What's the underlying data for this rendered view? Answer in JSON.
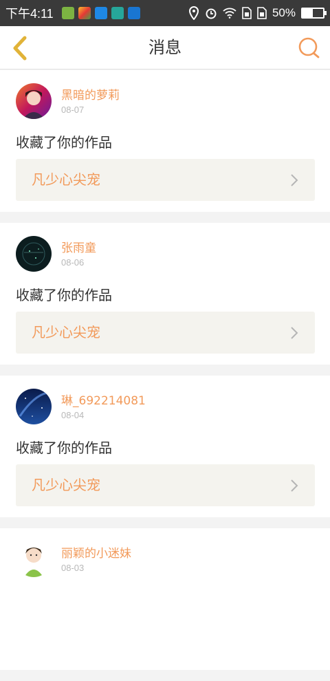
{
  "status_bar": {
    "time": "下午4:11",
    "battery_text": "50%",
    "battery_level": 0.5,
    "icons": [
      "app-icon-1",
      "app-icon-2",
      "app-icon-3",
      "app-icon-4",
      "app-icon-5",
      "location-icon",
      "alarm-icon",
      "wifi-icon",
      "sim1-icon",
      "sim2-icon",
      "battery-icon"
    ]
  },
  "topbar": {
    "title": "消息",
    "back_icon": "chevron-left-icon",
    "search_icon": "search-icon",
    "accent": "#f29a5a",
    "back_color": "#e1b338"
  },
  "messages": [
    {
      "user": "黑暗的萝莉",
      "date": "08-07",
      "action": "收藏了你的作品",
      "work": "凡少心尖宠"
    },
    {
      "user": "张雨童",
      "date": "08-06",
      "action": "收藏了你的作品",
      "work": "凡少心尖宠"
    },
    {
      "user": "琳_692214081",
      "date": "08-04",
      "action": "收藏了你的作品",
      "work": "凡少心尖宠"
    },
    {
      "user": "丽颖的小迷妹",
      "date": "08-03"
    }
  ]
}
